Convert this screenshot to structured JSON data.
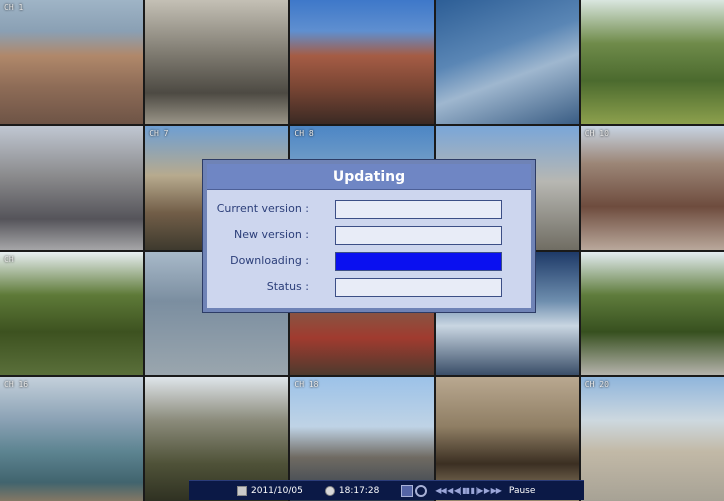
{
  "cameras": [
    {
      "label": "CH 1"
    },
    {
      "label": ""
    },
    {
      "label": ""
    },
    {
      "label": ""
    },
    {
      "label": ""
    },
    {
      "label": ""
    },
    {
      "label": "CH 7"
    },
    {
      "label": "CH 8"
    },
    {
      "label": ""
    },
    {
      "label": "CH 10"
    },
    {
      "label": "CH"
    },
    {
      "label": ""
    },
    {
      "label": ""
    },
    {
      "label": ""
    },
    {
      "label": ""
    },
    {
      "label": "CH 16"
    },
    {
      "label": ""
    },
    {
      "label": "CH 18"
    },
    {
      "label": ""
    },
    {
      "label": "CH 20"
    }
  ],
  "dialog": {
    "title": "Updating",
    "current_version_label": "Current version :",
    "current_version_value": "",
    "new_version_label": "New version :",
    "new_version_value": "",
    "downloading_label": "Downloading :",
    "downloading_progress": 1.0,
    "status_label": "Status :",
    "status_value": ""
  },
  "statusbar": {
    "date": "2011/10/05",
    "time": "18:17:28",
    "controls": "◀◀ ◀ ◀| ▮▮ ▮ |▶ ▶ ▶▶",
    "mode": "Pause"
  },
  "colors": {
    "dialog_bg": "#cdd6ee",
    "dialog_title_bg": "#6f86c4",
    "progress_fill": "#0a10f0",
    "statusbar_bg": "#0b1946"
  }
}
